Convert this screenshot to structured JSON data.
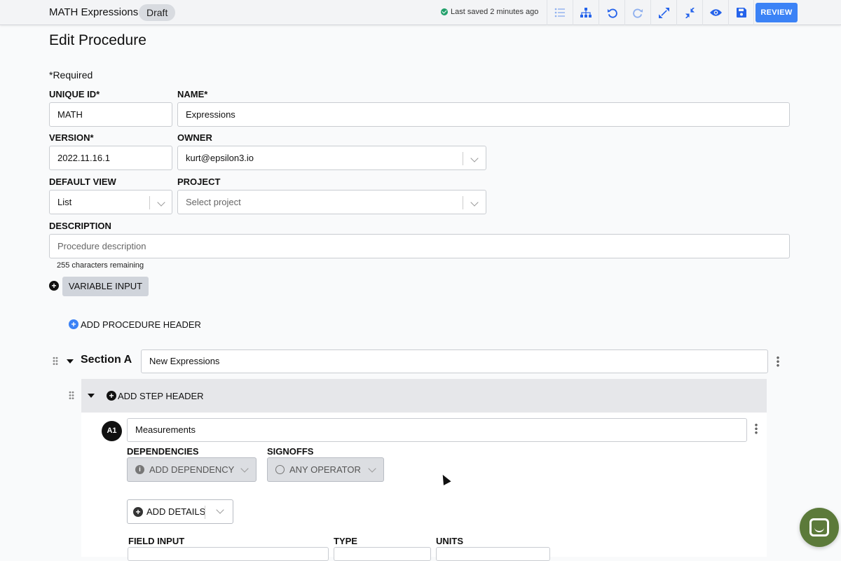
{
  "topbar": {
    "title": "MATH Expressions",
    "status_badge": "Draft",
    "saved_text": "Last saved 2 minutes ago",
    "review_label": "REVIEW",
    "icons": [
      "list-icon",
      "hierarchy-icon",
      "undo-icon",
      "redo-icon",
      "expand-icon",
      "collapse-icon",
      "preview-eye-icon",
      "save-icon"
    ]
  },
  "page": {
    "title": "Edit Procedure",
    "required_note": "*Required"
  },
  "form": {
    "unique_id": {
      "label": "UNIQUE ID*",
      "value": "MATH"
    },
    "name": {
      "label": "NAME*",
      "value": "Expressions"
    },
    "version": {
      "label": "VERSION*",
      "value": "2022.11.16.1"
    },
    "owner": {
      "label": "OWNER",
      "value": "kurt@epsilon3.io"
    },
    "default_view": {
      "label": "DEFAULT VIEW",
      "value": "List"
    },
    "project": {
      "label": "PROJECT",
      "placeholder": "Select project"
    },
    "description": {
      "label": "DESCRIPTION",
      "placeholder": "Procedure description",
      "counter": "255 characters remaining"
    },
    "variable_input_label": "VARIABLE INPUT",
    "add_procedure_header_label": "ADD PROCEDURE HEADER"
  },
  "section": {
    "title": "Section A",
    "name_value": "New Expressions",
    "add_step_header_label": "ADD STEP HEADER"
  },
  "step": {
    "badge": "A1",
    "name_value": "Measurements",
    "dependencies_label": "DEPENDENCIES",
    "add_dependency_label": "ADD DEPENDENCY",
    "signoffs_label": "SIGNOFFS",
    "any_operator_label": "ANY OPERATOR",
    "add_details_label": "ADD DETAILS",
    "field_input_label": "FIELD INPUT",
    "type_label": "TYPE",
    "units_label": "UNITS"
  },
  "colors": {
    "accent": "#3b82f6",
    "saved_green": "#22a06b",
    "chat_bubble": "#5c7a3a"
  }
}
